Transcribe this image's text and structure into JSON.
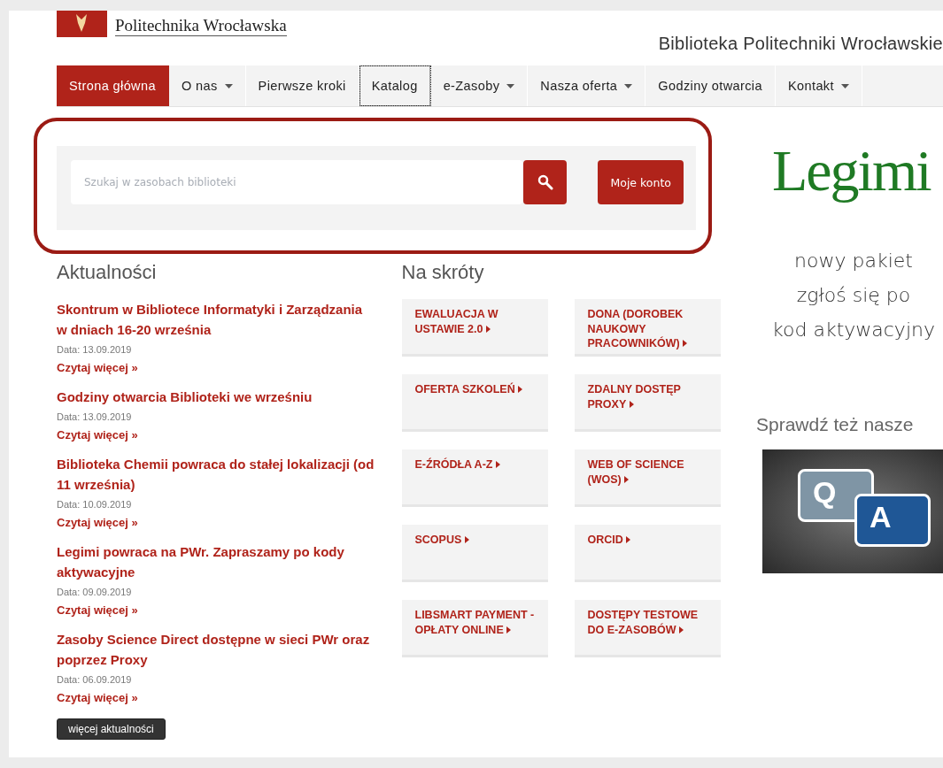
{
  "header": {
    "logo_text": "Politechnika Wrocławska",
    "site_title": "Biblioteka Politechniki Wrocławskie"
  },
  "nav": [
    {
      "label": "Strona główna",
      "selected": true,
      "dropdown": false,
      "focused": false
    },
    {
      "label": "O nas",
      "selected": false,
      "dropdown": true,
      "focused": false
    },
    {
      "label": "Pierwsze kroki",
      "selected": false,
      "dropdown": false,
      "focused": false
    },
    {
      "label": "Katalog",
      "selected": false,
      "dropdown": false,
      "focused": true
    },
    {
      "label": "e-Zasoby",
      "selected": false,
      "dropdown": true,
      "focused": false
    },
    {
      "label": "Nasza oferta",
      "selected": false,
      "dropdown": true,
      "focused": false
    },
    {
      "label": "Godziny otwarcia",
      "selected": false,
      "dropdown": false,
      "focused": false
    },
    {
      "label": "Kontakt",
      "selected": false,
      "dropdown": true,
      "focused": false
    }
  ],
  "search": {
    "placeholder": "Szukaj w zasobach biblioteki",
    "account_button": "Moje konto"
  },
  "news": {
    "title": "Aktualności",
    "items": [
      {
        "title": "Skontrum w Bibliotece Informatyki i Zarządzania w dniach 16-20 września",
        "date": "Data: 13.09.2019",
        "more": "Czytaj więcej »"
      },
      {
        "title": "Godziny otwarcia Biblioteki we wrześniu",
        "date": "Data: 13.09.2019",
        "more": "Czytaj więcej »"
      },
      {
        "title": "Biblioteka Chemii powraca do stałej lokalizacji (od 11 września)",
        "date": "Data: 10.09.2019",
        "more": "Czytaj więcej »"
      },
      {
        "title": "Legimi powraca na PWr. Zapraszamy po kody aktywacyjne",
        "date": "Data: 09.09.2019",
        "more": "Czytaj więcej »"
      },
      {
        "title": "Zasoby Science Direct dostępne w sieci PWr oraz poprzez Proxy",
        "date": "Data: 06.09.2019",
        "more": "Czytaj więcej »"
      }
    ],
    "more_button": "więcej aktualności"
  },
  "shortcuts": {
    "title": "Na skróty",
    "items": [
      "EWALUACJA W USTAWIE 2.0",
      "DONA (DOROBEK NAUKOWY PRACOWNIKÓW)",
      "OFERTA SZKOLEŃ",
      "ZDALNY DOSTĘP PROXY",
      "E-ŹRÓDŁA A-Z",
      "WEB OF SCIENCE (WOS)",
      "SCOPUS",
      "ORCID",
      "LIBSMART PAYMENT - OPŁATY ONLINE",
      "DOSTĘPY TESTOWE DO E-ZASOBÓW"
    ]
  },
  "sidebar": {
    "legimi_logo": "Legimi",
    "legimi_lines": [
      "nowy pakiet",
      "zgłoś się po",
      "kod aktywacyjny"
    ],
    "also_title": "Sprawdź też nasze",
    "banner_q": "Q",
    "banner_a": "A"
  }
}
